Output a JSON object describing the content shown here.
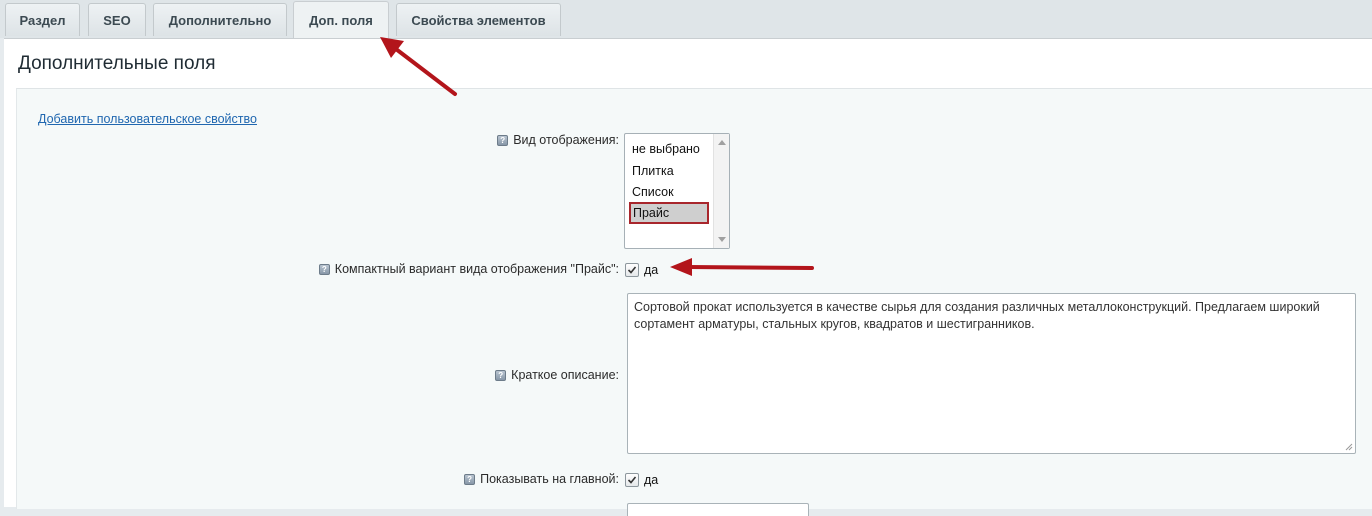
{
  "tabs": [
    {
      "label": "Раздел"
    },
    {
      "label": "SEO"
    },
    {
      "label": "Дополнительно"
    },
    {
      "label": "Доп. поля"
    },
    {
      "label": "Свойства элементов"
    }
  ],
  "panel": {
    "title": "Дополнительные поля",
    "add_link": "Добавить пользовательское свойство"
  },
  "fields": {
    "display_view": {
      "label": "Вид отображения:",
      "options": [
        "не выбрано",
        "Плитка",
        "Список",
        "Прайс"
      ],
      "selected": "Прайс"
    },
    "compact_price": {
      "label": "Компактный вариант вида отображения \"Прайс\":",
      "checkbox_label": "да",
      "checked": true
    },
    "short_description": {
      "label": "Краткое описание:",
      "value": "Сортовой прокат используется в качестве сырья для создания различных металлоконструкций. Предлагаем широкий сортамент арматуры, стальных кругов, квадратов и шестигранников."
    },
    "show_on_main": {
      "label": "Показывать на главной:",
      "checkbox_label": "да",
      "checked": true
    }
  },
  "colors": {
    "annotation_arrow": "#b3151b",
    "selected_border": "#a8262c",
    "link": "#2067b0"
  },
  "icons": {
    "help": "help-icon",
    "checkmark": "checkmark-icon",
    "annotation": "red-arrow-icon"
  }
}
